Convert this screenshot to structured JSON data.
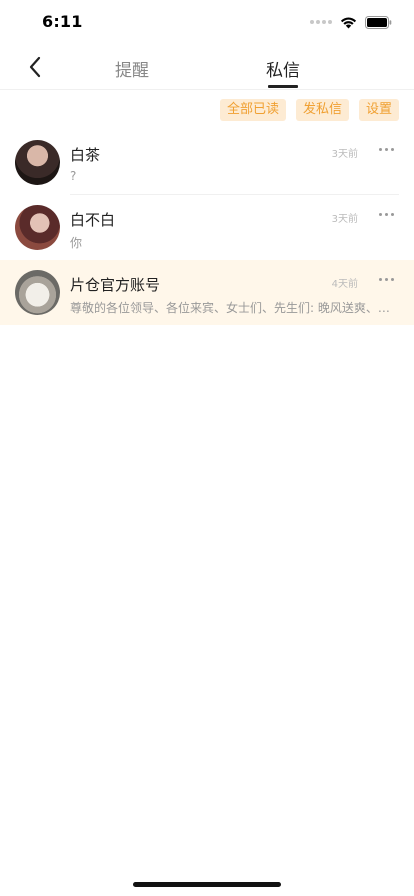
{
  "status_bar": {
    "time": "6:11"
  },
  "nav": {
    "back_icon": "chevron-left-icon",
    "tabs": [
      {
        "label": "提醒",
        "active": false
      },
      {
        "label": "私信",
        "active": true
      }
    ]
  },
  "actions": {
    "mark_all_read": "全部已读",
    "send_message": "发私信",
    "settings": "设置"
  },
  "colors": {
    "accent": "#f0a032",
    "accent_bg": "#fdebd3",
    "highlight_row": "#fff7ea"
  },
  "messages": [
    {
      "name": "白茶",
      "preview": "?",
      "time": "3天前"
    },
    {
      "name": "白不白",
      "preview": "你",
      "time": "3天前"
    },
    {
      "name": "片仓官方账号",
      "preview": "尊敬的各位领导、各位来宾、女士们、先生们: 晚风送爽、丹桂飘香",
      "time": "4天前"
    }
  ]
}
